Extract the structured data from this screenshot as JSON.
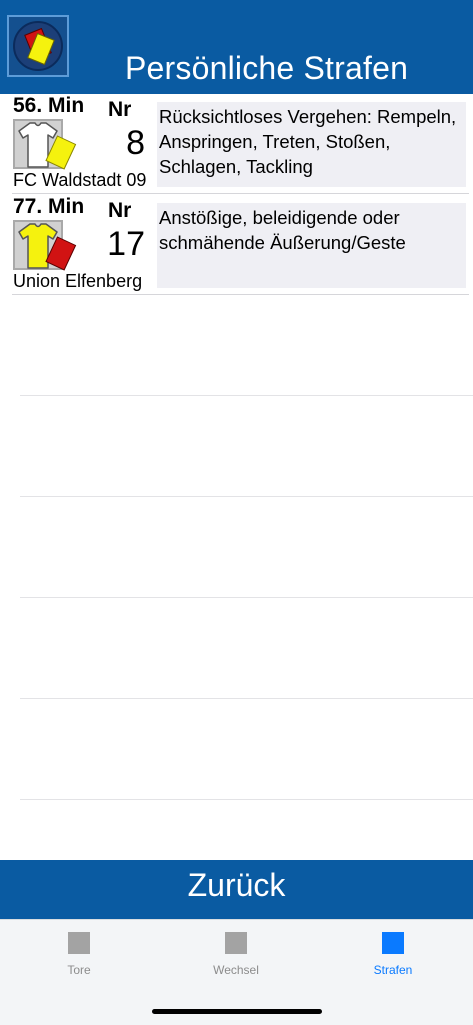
{
  "header": {
    "title": "Persönliche Strafen",
    "icon": "cards-icon"
  },
  "penalties": [
    {
      "minute": "56. Min",
      "nr_label": "Nr",
      "player_nr": "8",
      "team": "FC Waldstadt 09",
      "jersey_color": "#ffffff",
      "card": "yellow-card",
      "card_color": "#f5f20e",
      "description": "Rücksichtloses Vergehen: Rempeln, Anspringen, Treten, Stoßen, Schlagen, Tackling"
    },
    {
      "minute": "77. Min",
      "nr_label": "Nr",
      "player_nr": "17",
      "team": "Union Elfenberg",
      "jersey_color": "#f5f20e",
      "card": "red-card",
      "card_color": "#d11313",
      "description": "Anstößige, beleidigende oder schmähende Äußerung/Geste"
    }
  ],
  "back_button": {
    "label": "Zurück"
  },
  "tabs": [
    {
      "label": "Tore",
      "active": false
    },
    {
      "label": "Wechsel",
      "active": false
    },
    {
      "label": "Strafen",
      "active": true
    }
  ],
  "colors": {
    "primary": "#0a5ba2",
    "tab_active": "#0a7aff",
    "tab_inactive": "#8c8c8c",
    "description_bg": "#efeff4"
  }
}
